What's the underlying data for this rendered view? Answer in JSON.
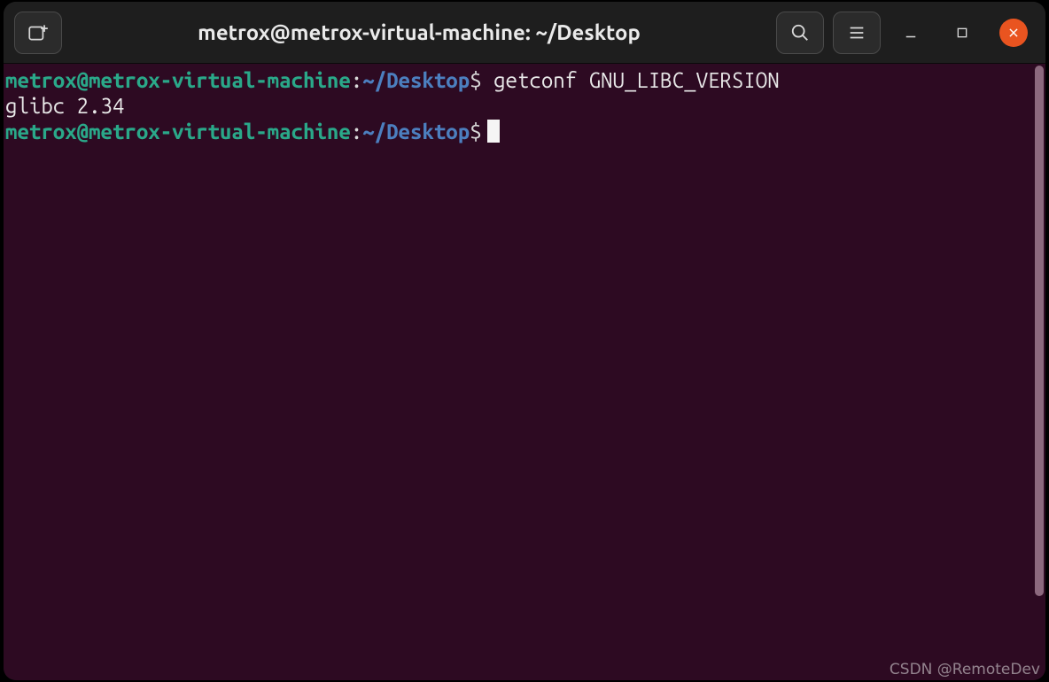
{
  "titlebar": {
    "title": "metrox@metrox-virtual-machine: ~/Desktop"
  },
  "prompt": {
    "user_host": "metrox@metrox-virtual-machine",
    "colon": ":",
    "path": "~/Desktop",
    "symbol": "$"
  },
  "lines": {
    "cmd1": "getconf GNU_LIBC_VERSION",
    "out1": "glibc 2.34"
  },
  "watermark": "CSDN @RemoteDev",
  "colors": {
    "terminal_bg": "#2d0a22",
    "prompt_user": "#2aa889",
    "prompt_path": "#4c7fbf",
    "close_btn": "#e95420"
  }
}
